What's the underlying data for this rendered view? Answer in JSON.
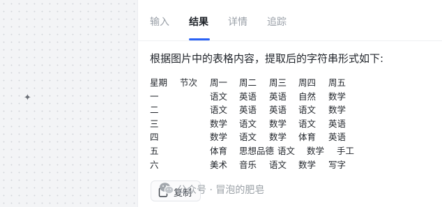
{
  "cursor": {
    "glyph": "✦"
  },
  "tabs": [
    {
      "label": "输入"
    },
    {
      "label": "结果",
      "active": true
    },
    {
      "label": "详情"
    },
    {
      "label": "追踪"
    }
  ],
  "result": {
    "question": "根据图片中的表格内容，提取后的字符串形式如下:",
    "header": [
      "星期",
      "节次",
      "周一",
      "周二",
      "周三",
      "周四",
      "周五"
    ],
    "rows": [
      [
        "一",
        "",
        "语文",
        "英语",
        "英语",
        "自然",
        "数学"
      ],
      [
        "二",
        "",
        "语文",
        "英语",
        "英语",
        "语文",
        "数学"
      ],
      [
        "三",
        "",
        "数学",
        "语文",
        "数学",
        "语文",
        "英语"
      ],
      [
        "四",
        "",
        "数学",
        "语文",
        "数学",
        "体育",
        "英语"
      ],
      [
        "五",
        "",
        "体育",
        "思想品德",
        "语文",
        "数学",
        "手工"
      ],
      [
        "六",
        "",
        "美术",
        "音乐",
        "语文",
        "数学",
        "写字"
      ]
    ]
  },
  "actions": {
    "copy_label": "复制"
  },
  "watermark": {
    "text": "公众号 · 冒泡的肥皂",
    "icon": "wechat-icon"
  },
  "colors": {
    "accent": "#2a62f5",
    "text": "#1f2329",
    "muted": "#9aa0a8"
  }
}
